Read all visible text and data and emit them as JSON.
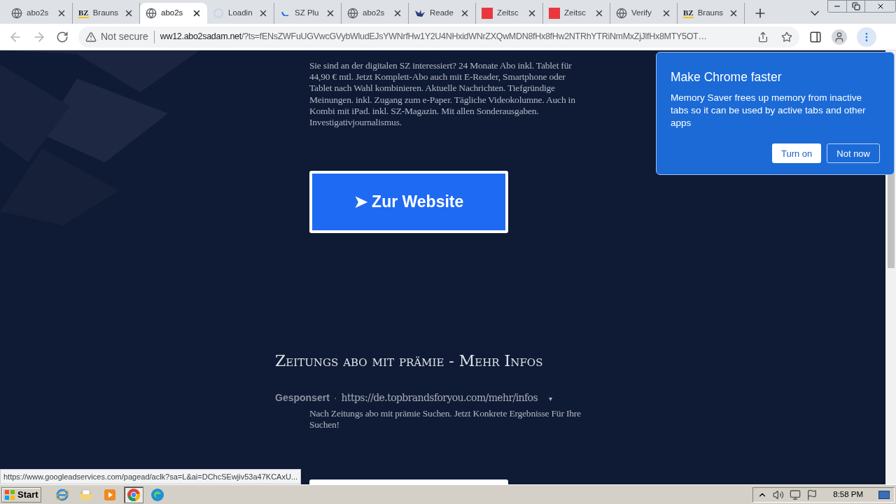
{
  "tabs": [
    {
      "title": "abo2s",
      "kind": "globe",
      "selected": false
    },
    {
      "title": "Brauns",
      "kind": "logo",
      "logo_text": "BZ",
      "selected": false
    },
    {
      "title": "abo2s",
      "kind": "globe",
      "selected": true
    },
    {
      "title": "Loadin",
      "kind": "loading",
      "selected": false
    },
    {
      "title": "SZ Plu",
      "kind": "spinner",
      "selected": false
    },
    {
      "title": "abo2s",
      "kind": "globe",
      "selected": false
    },
    {
      "title": "Reade",
      "kind": "bird",
      "selected": false
    },
    {
      "title": "Zeitsc",
      "kind": "square",
      "selected": false
    },
    {
      "title": "Zeitsc",
      "kind": "square",
      "selected": false
    },
    {
      "title": "Verify",
      "kind": "globe",
      "selected": false
    },
    {
      "title": "Brauns",
      "kind": "logo",
      "logo_text": "BZ",
      "selected": false
    }
  ],
  "address_bar": {
    "security": "Not secure",
    "host": "ww12.abo2sadam.net",
    "path": "/?ts=fENsZWFuUGVwcGVybWludEJsYWNrfHw1Y2U4NHxidWNrZXQwMDN8fHx8fHw2NTRhYTRiNmMxZjJlfHx8MTY5OT…"
  },
  "ads": [
    {
      "description": "Sie sind an der digitalen SZ interessiert? 24 Monate Abo inkl. Tablet für 44,90 € mtl. Jetzt Komplett-Abo auch mit E-Reader, Smartphone oder Tablet nach Wahl kombinieren. Aktuelle Nachrichten. Tiefgründige Meinungen. inkl. Zugang zum e-Paper. Tägliche Videokolumne. Auch in Kombi mit iPad. inkl. SZ-Magazin. Mit allen Sonderausgaben. Investigativjournalismus.",
      "button": "➤ Zur Website"
    },
    {
      "title": "Zeitungs abo mit prämie - Mehr Infos",
      "sponsor": "Gesponsert",
      "separator": "·",
      "url": "https://de.topbrandsforyou.com/mehr/infos",
      "caret": "▾",
      "description": "Nach Zeitungs abo mit prämie Suchen. Jetzt Konkrete Ergebnisse Für Ihre Suchen!"
    }
  ],
  "popup": {
    "title": "Make Chrome faster",
    "body": "Memory Saver frees up memory from inactive tabs so it can be used by active tabs and other apps",
    "buttons": [
      {
        "label": "Turn on",
        "kind": "primary"
      },
      {
        "label": "Not now",
        "kind": "secondary"
      }
    ]
  },
  "status_link": "https://www.googleadservices.com/pagead/aclk?sa=L&ai=DChcSEwjiv53a47KCAxU...",
  "taskbar": {
    "start": "Start",
    "clock": "8:58 PM",
    "apps": [
      {
        "kind": "ie",
        "selected": false
      },
      {
        "kind": "folder",
        "selected": false
      },
      {
        "kind": "media",
        "selected": false
      },
      {
        "kind": "chrome",
        "selected": true
      },
      {
        "kind": "edge",
        "selected": false
      }
    ]
  }
}
